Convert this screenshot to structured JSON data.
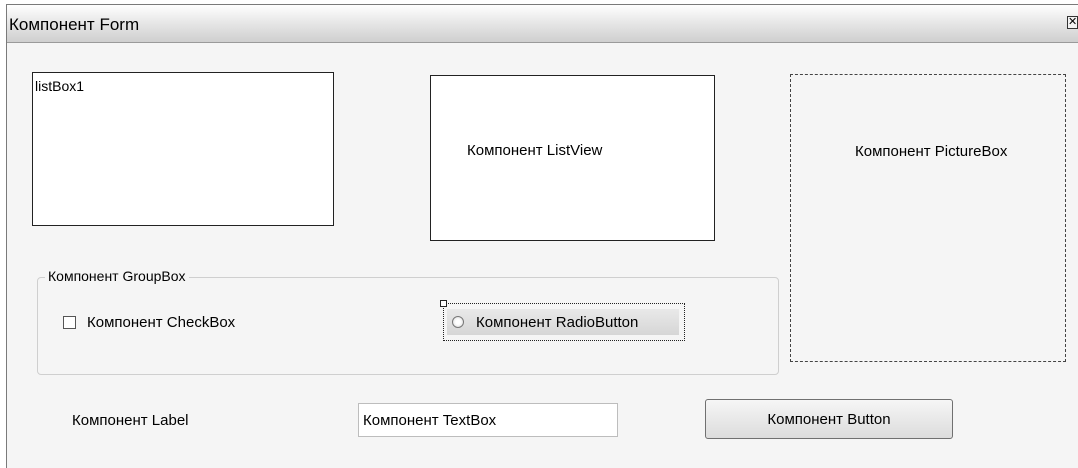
{
  "window": {
    "title": "Компонент Form",
    "close_glyph": "✕"
  },
  "listbox": {
    "items": [
      "listBox1"
    ]
  },
  "listview": {
    "text": "Компонент ListView"
  },
  "picturebox": {
    "text": "Компонент PictureBox"
  },
  "groupbox": {
    "caption": "Компонент GroupBox",
    "checkbox_label": "Компонент CheckBox",
    "checkbox_checked": false,
    "radio_label": "Компонент RadioButton",
    "radio_selected": false
  },
  "label": {
    "text": "Компонент Label"
  },
  "textbox": {
    "value": "Компонент TextBox"
  },
  "button": {
    "label": "Компонент Button"
  }
}
